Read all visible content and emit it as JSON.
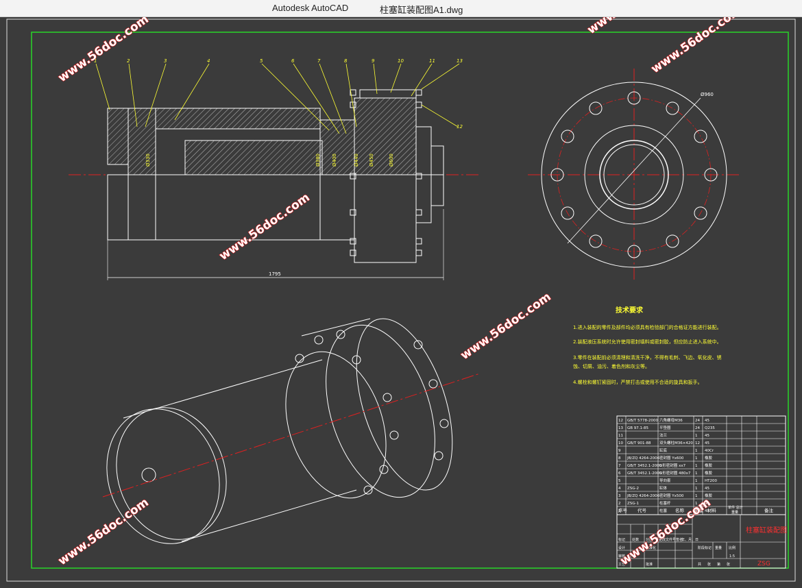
{
  "window": {
    "app_title": "Autodesk AutoCAD",
    "document_title": "柱塞缸装配图A1.dwg"
  },
  "drawing": {
    "part_numbers": [
      "1",
      "2",
      "3",
      "4",
      "5",
      "6",
      "7",
      "8",
      "9",
      "10",
      "11",
      "13",
      "12"
    ],
    "dims": {
      "length": "1795",
      "flange_diameter": "Ø960",
      "d1": "Ø330",
      "d2": "Ø380",
      "d3": "Ø400",
      "d4": "Ø440",
      "d5": "Ø450",
      "d6": "Ø600"
    },
    "tech": {
      "title": "技术要求",
      "items": [
        "1.进入装配的零件及部件均必须具有检验部门的合格证方能进行装配。",
        "2.装配液压系统时允许使用密封填料或密封胶，但应防止进入系统中。",
        "3.零件在装配前必须清理和清洗干净，不得有毛刺、飞边、氧化皮、锈",
        "蚀、切屑、油污、着色剂和灰尘等。",
        "4.螺栓和螺钉紧固时，严禁打击或使用不合适的旋具和扳手。"
      ]
    },
    "bom": {
      "rows": [
        {
          "no": "12",
          "code": "GB/T 5778-2000",
          "name": "六角螺母M36",
          "qty": "24",
          "mat": "45"
        },
        {
          "no": "13",
          "code": "GB 97.1-85",
          "name": "平垫圈",
          "qty": "24",
          "mat": "Q235"
        },
        {
          "no": "11",
          "code": "",
          "name": "法兰",
          "qty": "1",
          "mat": "45"
        },
        {
          "no": "10",
          "code": "GB/T 901-88",
          "name": "双头螺柱M36×420",
          "qty": "12",
          "mat": "45"
        },
        {
          "no": "9",
          "code": "",
          "name": "缸底",
          "qty": "1",
          "mat": "40Cr"
        },
        {
          "no": "8",
          "code": "JB/ZQ 4264-2006",
          "name": "密封圈 Yx600",
          "qty": "1",
          "mat": "橡胶"
        },
        {
          "no": "7",
          "code": "GB/T 3452.1-2005",
          "name": "O形密封圈 xx7",
          "qty": "1",
          "mat": "橡胶"
        },
        {
          "no": "6",
          "code": "GB/T 3452.1-2005",
          "name": "O形密封圈 480x7",
          "qty": "1",
          "mat": "橡胶"
        },
        {
          "no": "5",
          "code": "",
          "name": "导向套",
          "qty": "1",
          "mat": "HT200"
        },
        {
          "no": "4",
          "code": "ZSG-2",
          "name": "缸体",
          "qty": "1",
          "mat": "45"
        },
        {
          "no": "3",
          "code": "JB/ZQ 4264-2006",
          "name": "密封圈 Yx500",
          "qty": "1",
          "mat": "橡胶"
        },
        {
          "no": "2",
          "code": "ZSG-1",
          "name": "柱塞杆",
          "qty": "1",
          "mat": "45"
        },
        {
          "no": "1",
          "code": "",
          "name": "柱塞",
          "qty": "1",
          "mat": "45"
        }
      ],
      "header": {
        "no": "序号",
        "code": "代号",
        "name": "名称",
        "qty": "数量",
        "mat": "材料",
        "unit": "单件 总计",
        "weight": "重量",
        "note": "备注"
      }
    },
    "titleblock": {
      "drawing_name": "柱塞缸装配图",
      "drawing_code": "ZSG",
      "labels": [
        "标记",
        "处数",
        "分区",
        "更改文件号",
        "签名",
        "年、月、日",
        "设计",
        "标准化",
        "审核",
        "工艺",
        "批准",
        "阶段标记",
        "重量",
        "比例"
      ],
      "sheet": [
        "共",
        "张",
        "第",
        "张"
      ],
      "scale": "1:5"
    },
    "watermark": "www.56doc.com"
  }
}
